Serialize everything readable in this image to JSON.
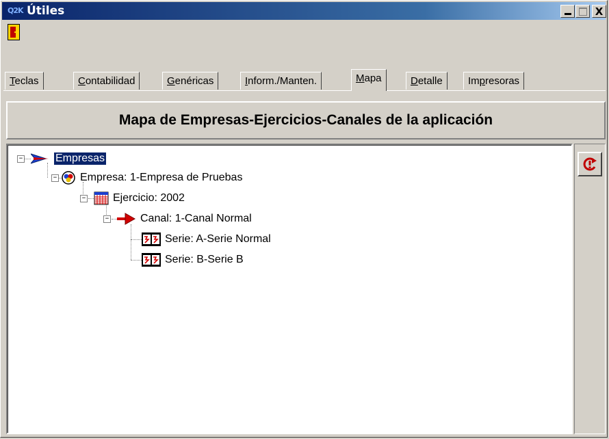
{
  "window": {
    "icon_text": "Q2K",
    "title": "Útiles"
  },
  "titlebar_buttons": {
    "minimize": "_",
    "maximize": "□",
    "close": "X"
  },
  "toolbar": {
    "exit_icon": "door-exit-icon"
  },
  "tabs": [
    {
      "label": "Teclas",
      "accel": "T",
      "rest": "eclas",
      "active": false
    },
    {
      "label": "Contabilidad",
      "accel": "C",
      "rest": "ontabilidad",
      "active": false
    },
    {
      "label": "Genéricas",
      "accel": "G",
      "rest": "enéricas",
      "active": false
    },
    {
      "label": "Inform./Manten.",
      "accel": "I",
      "rest": "nform./Manten.",
      "active": false
    },
    {
      "label": "Mapa",
      "accel": "M",
      "rest": "apa",
      "active": true
    },
    {
      "label": "Detalle",
      "accel": "D",
      "rest": "etalle",
      "active": false
    },
    {
      "label": "Impresoras",
      "pre": "Im",
      "accel": "p",
      "rest": "resoras",
      "active": false
    }
  ],
  "header": {
    "title": "Mapa de Empresas-Ejercicios-Canales de la aplicación"
  },
  "tree": {
    "root": {
      "label": "Empresas",
      "icon": "blue-arrow-icon",
      "selected": true
    },
    "empresa": {
      "label": "Empresa: 1-Empresa de Pruebas",
      "icon": "company-icon"
    },
    "ejercicio": {
      "label": "Ejercicio: 2002",
      "icon": "calendar-icon"
    },
    "canal": {
      "label": "Canal: 1-Canal Normal",
      "icon": "red-arrow-icon"
    },
    "series": [
      {
        "label": "Serie: A-Serie Normal",
        "icon": "film-serie-icon"
      },
      {
        "label": "Serie: B-Serie B",
        "icon": "film-serie-icon"
      }
    ]
  },
  "side": {
    "refresh_icon": "refresh-icon"
  },
  "colors": {
    "titlebar_start": "#0a246a",
    "face": "#d4d0c8",
    "selection": "#0a246a",
    "accent_red": "#c00000"
  }
}
